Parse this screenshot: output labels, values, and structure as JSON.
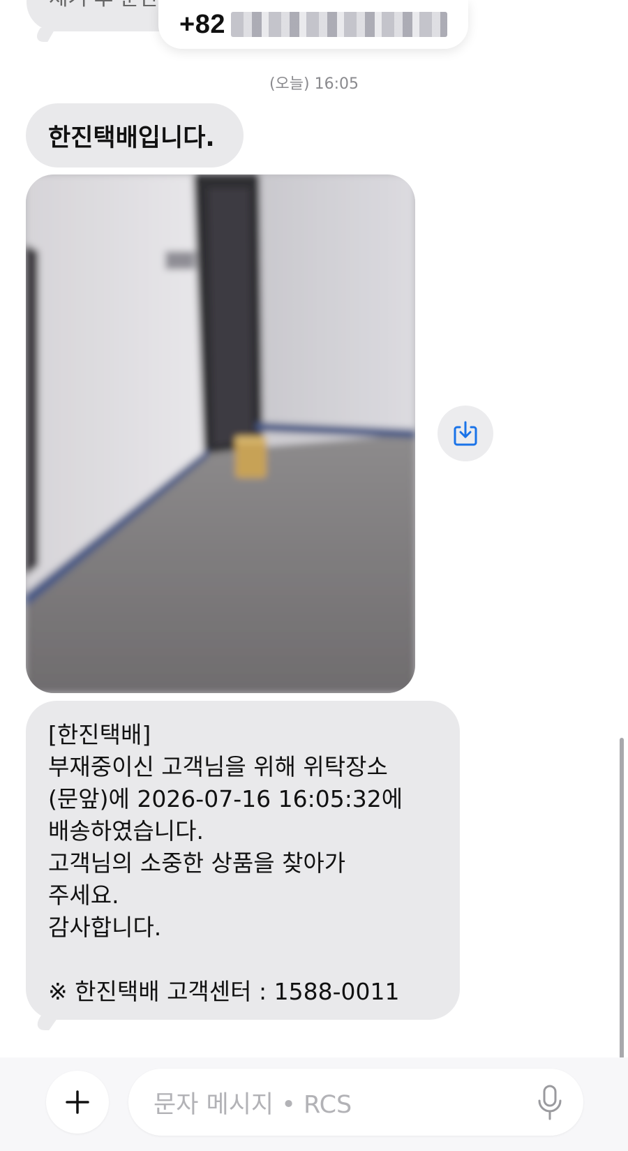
{
  "previous_message": {
    "partial_text": "제거 후 문단"
  },
  "header": {
    "phone_prefix": "+82"
  },
  "timestamp": "(오늘) 16:05",
  "messages": [
    {
      "type": "text",
      "text": "한진택배입니다."
    },
    {
      "type": "image",
      "icon": "download-icon"
    },
    {
      "type": "text",
      "lines": [
        "[한진택배]",
        "부재중이신 고객님을 위해 위탁장소",
        "(문앞)에 2026-07-16 16:05:32에",
        "배송하였습니다.",
        "고객님의 소중한 상품을 찾아가",
        "주세요.",
        "감사합니다.",
        "",
        "※ 한진택배 고객센터 : 1588-0011"
      ]
    }
  ],
  "compose": {
    "add_icon": "plus-icon",
    "placeholder": "문자 메시지 • RCS",
    "mic_icon": "mic-icon"
  },
  "colors": {
    "bubble": "#e9e9eb",
    "accent": "#1a73e8",
    "background": "#ffffff"
  }
}
